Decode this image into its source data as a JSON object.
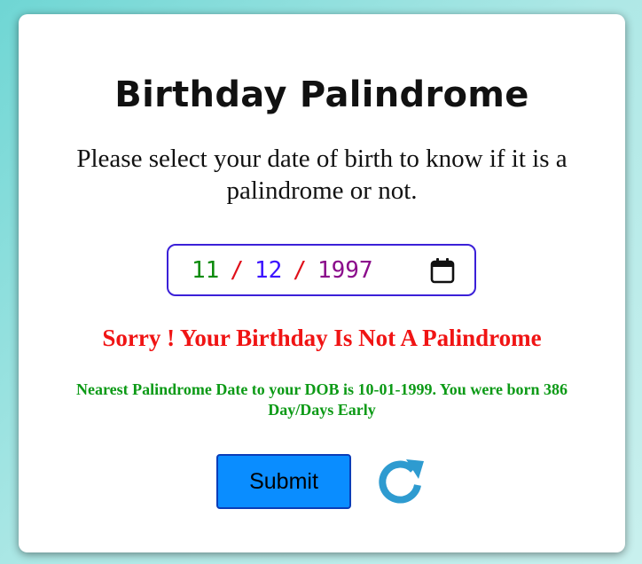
{
  "app": {
    "title": "Birthday Palindrome",
    "subtitle": "Please select your date of birth to know if it is a palindrome or not."
  },
  "date_input": {
    "day": "11",
    "month": "12",
    "year": "1997",
    "separator": "/",
    "icon": "calendar-icon"
  },
  "result": {
    "message": "Sorry ! Your Birthday Is Not A Palindrome",
    "nearest": "Nearest Palindrome Date to your DOB is 10-01-1999. You were born 386 Day/Days Early"
  },
  "actions": {
    "submit_label": "Submit",
    "reset_icon": "refresh-icon"
  },
  "colors": {
    "result_error": "#f01414",
    "nearest_info": "#0c9a16",
    "submit_bg": "#0a8dff",
    "input_border": "#3b20d8",
    "reset_icon": "#2e9bd0"
  }
}
